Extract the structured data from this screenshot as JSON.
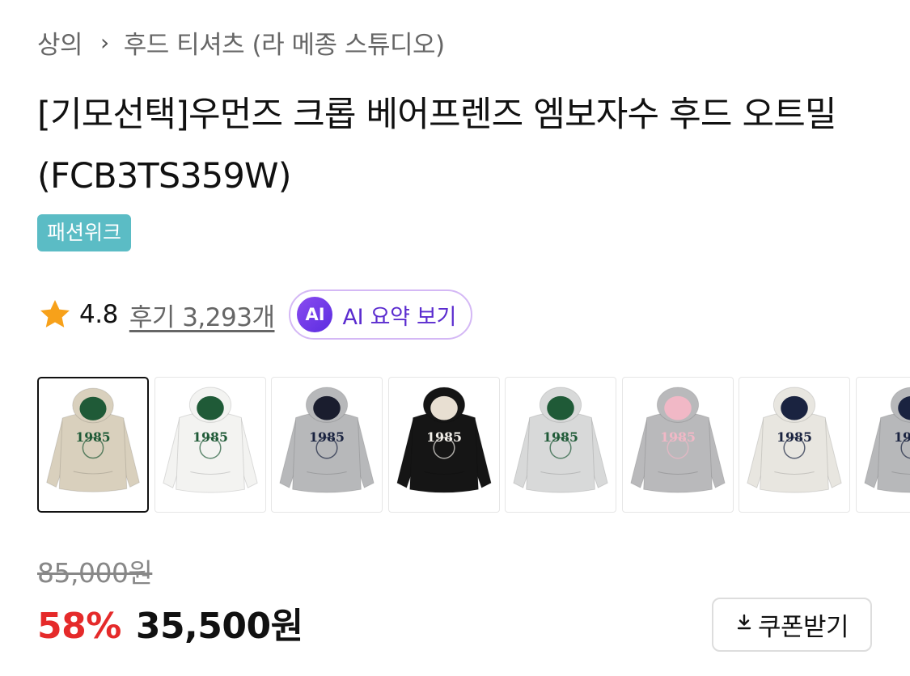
{
  "breadcrumb": {
    "category": "상의",
    "separator": "›",
    "subcategory": "후드 티셔츠 (라 메종 스튜디오)"
  },
  "product": {
    "title": "[기모선택]우먼즈 크롭 베어프렌즈 엠보자수 후드 오트밀(FCB3TS359W)",
    "badge": "패션위크",
    "rating": "4.8",
    "reviews_label": "후기 3,293개",
    "ai_icon_text": "AI",
    "ai_summary_label": "AI 요약 보기"
  },
  "thumbnails": [
    {
      "label": "oatmeal-hoodie",
      "body": "#d9d0bd",
      "hood": "#1f5a37",
      "text": "#1f5a37",
      "selected": true
    },
    {
      "label": "white-hoodie",
      "body": "#f3f3f1",
      "hood": "#1f5a37",
      "text": "#1f5a37",
      "selected": false
    },
    {
      "label": "gray-hoodie",
      "body": "#b7b8ba",
      "hood": "#1a1d2e",
      "text": "#1a2340",
      "selected": false
    },
    {
      "label": "black-hoodie",
      "body": "#151515",
      "hood": "#e8dfd2",
      "text": "#f1eee8",
      "selected": false
    },
    {
      "label": "light-gray-hoodie",
      "body": "#d8d9d9",
      "hood": "#1f5a37",
      "text": "#1f5a37",
      "selected": false
    },
    {
      "label": "gray-pink-hoodie",
      "body": "#b9b9bb",
      "hood": "#f1b8c6",
      "text": "#f1b8c6",
      "selected": false
    },
    {
      "label": "ivory-navy-hoodie",
      "body": "#e8e6e0",
      "hood": "#1a2340",
      "text": "#1a2340",
      "selected": false
    },
    {
      "label": "gray-navy-hoodie",
      "body": "#b7b8ba",
      "hood": "#1a2340",
      "text": "#1a2340",
      "selected": false
    }
  ],
  "thumbnail_text": "1985",
  "pricing": {
    "original_price": "85,000원",
    "discount_rate": "58%",
    "sale_price": "35,500원"
  },
  "coupon": {
    "icon": "download-icon",
    "label": "쿠폰받기"
  },
  "colors": {
    "badge": "#5bbcc5",
    "discount": "#e52a2a",
    "ai_accent": "#5b2ccf",
    "star": "#f7a11a"
  }
}
